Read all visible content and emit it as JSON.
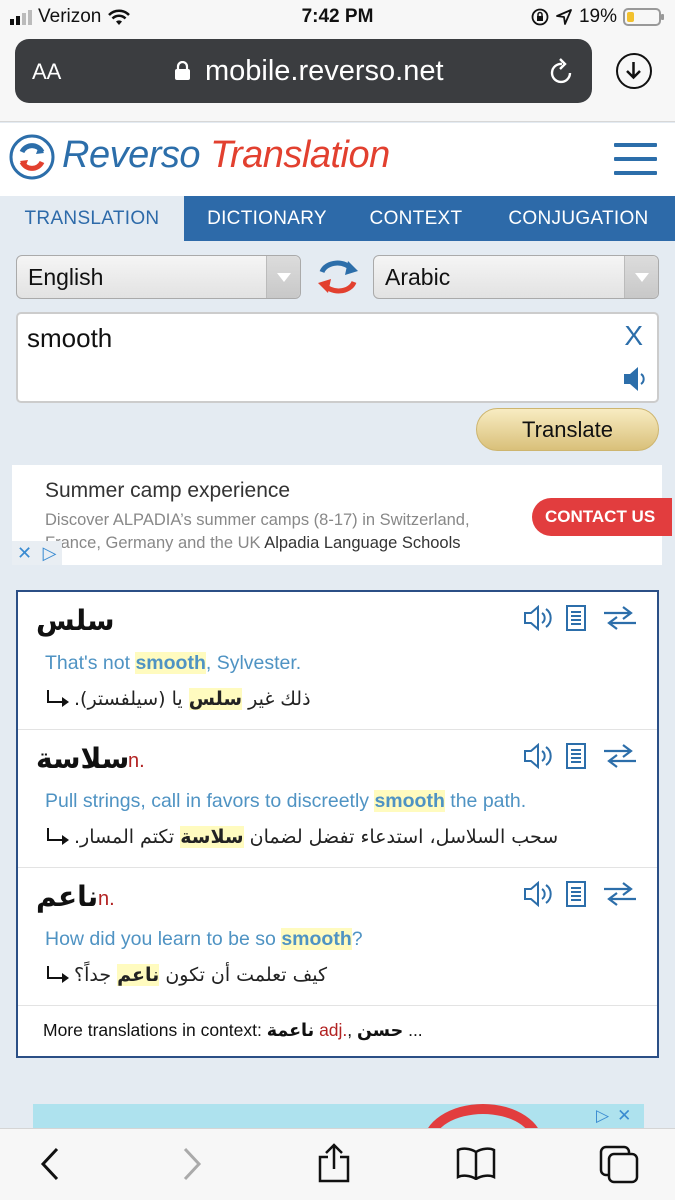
{
  "status_bar": {
    "carrier": "Verizon",
    "time": "7:42 PM",
    "battery": "19%"
  },
  "browser": {
    "text_size": "AA",
    "url": "mobile.reverso.net"
  },
  "header": {
    "logo_word1": "Reverso",
    "logo_word2": "Translation"
  },
  "tabs": [
    "TRANSLATION",
    "DICTIONARY",
    "CONTEXT",
    "CONJUGATION"
  ],
  "translator": {
    "source_lang": "English",
    "target_lang": "Arabic",
    "input_value": "smooth",
    "clear_label": "X",
    "translate_label": "Translate"
  },
  "ad": {
    "title": "Summer camp experience",
    "description": "Discover ALPADIA’s summer camps (8-17) in Switzerland, France, Germany and the UK",
    "brand": "Alpadia Language Schools",
    "cta": "CONTACT US"
  },
  "results": {
    "entries": [
      {
        "word": "سلس",
        "pos": "",
        "src_before": "That's not ",
        "src_highlight": "smooth",
        "src_after": ", Sylvester.",
        "tgt_before": "ذلك غير ",
        "tgt_highlight": "سلس",
        "tgt_after": " يا (سيلفستر)."
      },
      {
        "word": "سلاسة",
        "pos": "n.",
        "src_before": "Pull strings, call in favors to discreetly ",
        "src_highlight": "smooth",
        "src_after": " the path.",
        "tgt_before": "سحب السلاسل، استدعاء تفضل لضمان ",
        "tgt_highlight": "سلاسة",
        "tgt_after": " تكتم المسار."
      },
      {
        "word": "ناعم",
        "pos": "n.",
        "src_before": "How did you learn to be so ",
        "src_highlight": "smooth",
        "src_after": "?",
        "tgt_before": "كيف تعلمت أن تكون ",
        "tgt_highlight": "ناعم",
        "tgt_after": " جداً؟"
      }
    ],
    "more_label": "More translations in context:",
    "more_word1": "ناعمة",
    "more_pos1": "adj.",
    "more_sep": ",",
    "more_word2": "حسن",
    "more_ellipsis": "..."
  }
}
